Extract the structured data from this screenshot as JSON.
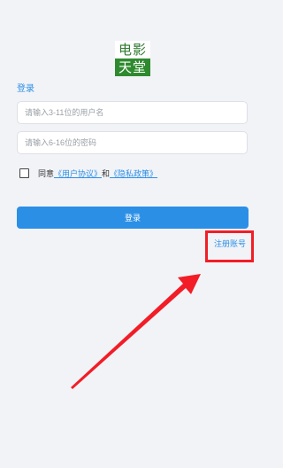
{
  "logo": {
    "line1": "电影",
    "line2": "天堂"
  },
  "login_title": "登录",
  "username": {
    "placeholder": "请输入3-11位的用户名",
    "value": ""
  },
  "password": {
    "placeholder": "请输入6-16位的密码",
    "value": ""
  },
  "agreement": {
    "prefix": "同意",
    "user_agreement": "《用户协议》",
    "conjunction": "和",
    "privacy_policy": "《隐私政策》",
    "checked": false
  },
  "login_button": "登录",
  "register_link": "注册账号",
  "colors": {
    "accent": "#2b8fe6",
    "annotation": "#f21d26",
    "logo_green": "#2f8a2f",
    "background": "#f2f3f7"
  }
}
